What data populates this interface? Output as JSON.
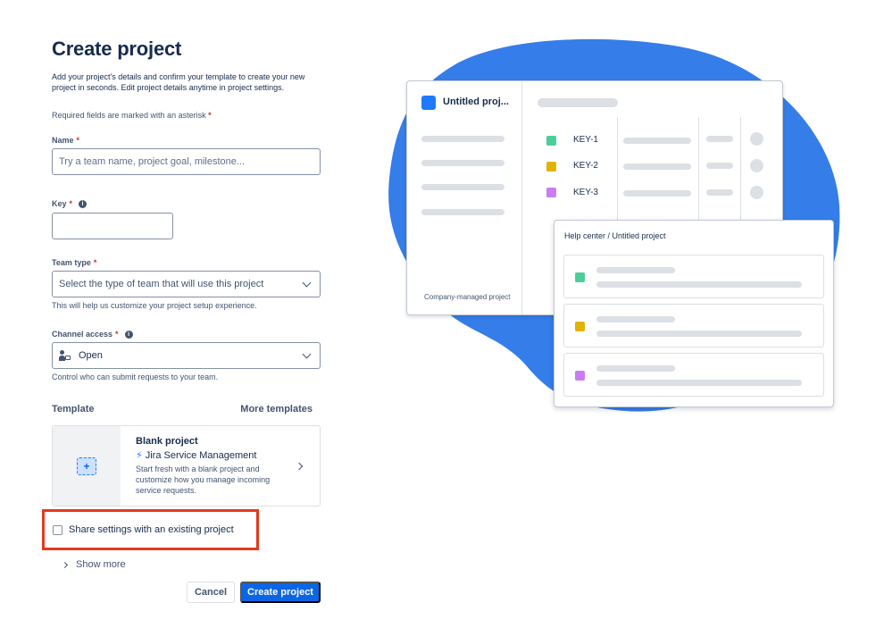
{
  "page": {
    "title": "Create project",
    "intro": "Add your project's details and confirm your template to create your new project in seconds. Edit project details anytime in project settings.",
    "required_note": "Required fields are marked with an asterisk",
    "asterisk": "*"
  },
  "fields": {
    "name": {
      "label": "Name",
      "placeholder": "Try a team name, project goal, milestone...",
      "value": ""
    },
    "key": {
      "label": "Key",
      "value": ""
    },
    "team_type": {
      "label": "Team type",
      "placeholder": "Select the type of team that will use this project",
      "helper": "This will help us customize your project setup experience."
    },
    "channel_access": {
      "label": "Channel access",
      "value": "Open",
      "helper": "Control who can submit requests to your team."
    }
  },
  "template": {
    "section_label": "Template",
    "more_link": "More templates",
    "card": {
      "name": "Blank project",
      "product": "Jira Service Management",
      "description": "Start fresh with a blank project and customize how you manage incoming service requests."
    }
  },
  "share_settings": {
    "label": "Share settings with an existing project",
    "checked": false
  },
  "show_more": "Show more",
  "buttons": {
    "cancel": "Cancel",
    "create": "Create project"
  },
  "illustration": {
    "project_name": "Untitled proj...",
    "footer_label": "Company-managed project",
    "keys": [
      "KEY-1",
      "KEY-2",
      "KEY-3"
    ],
    "key_colors": [
      "#4bce97",
      "#e2b203",
      "#c97cf4"
    ],
    "breadcrumb": "Help center  /  Untitled project",
    "blob_color": "#357de8"
  },
  "colors": {
    "primary": "#0c66e4",
    "highlight": "#e23a1e",
    "text": "#172b4d"
  }
}
